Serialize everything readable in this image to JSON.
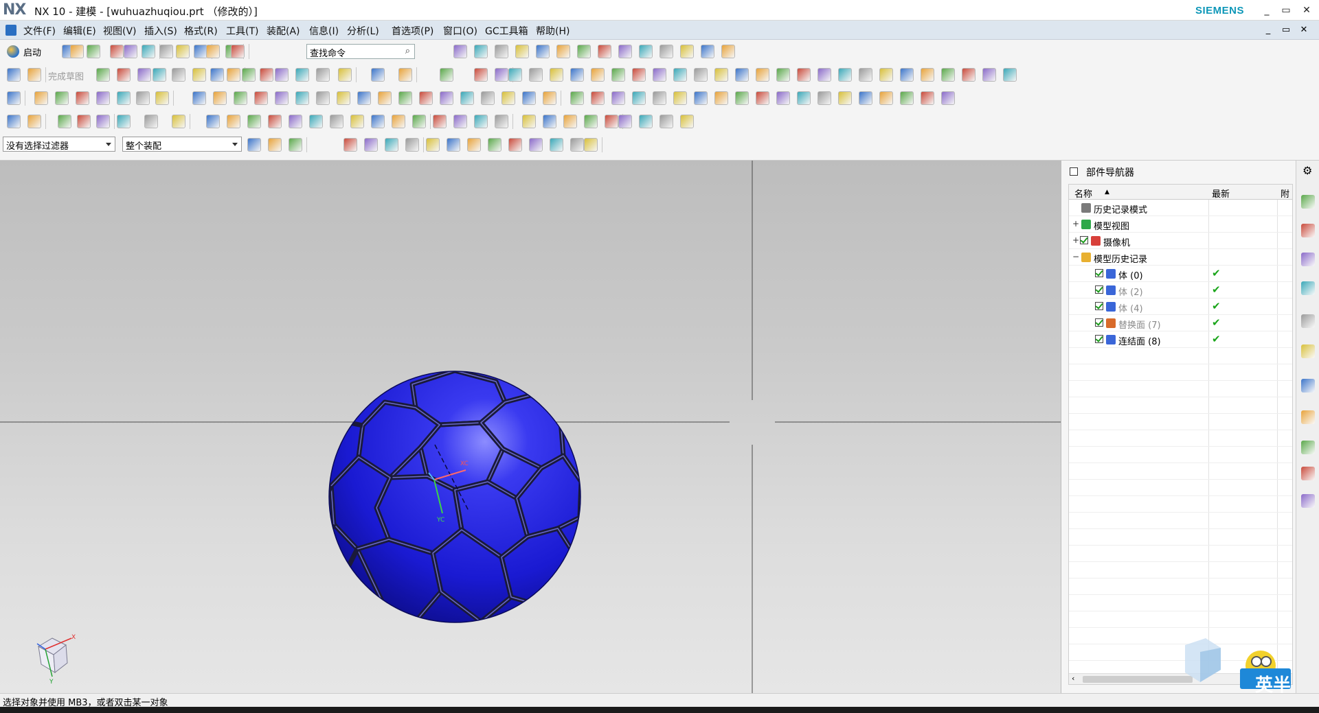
{
  "window": {
    "logo": "NX",
    "title": "NX 10 - 建模 - [wuhuazhuqiou.prt （修改的）]",
    "brand": "SIEMENS",
    "controls": [
      "_",
      "▭",
      "✕"
    ]
  },
  "menu": {
    "items": [
      "文件(F)",
      "编辑(E)",
      "视图(V)",
      "插入(S)",
      "格式(R)",
      "工具(T)",
      "装配(A)",
      "信息(I)",
      "分析(L)",
      "首选项(P)",
      "窗口(O)",
      "GC工具箱",
      "帮助(H)"
    ],
    "controls": [
      "_",
      "▭",
      "✕"
    ]
  },
  "toolbar": {
    "launch_label": "启动",
    "finish_sketch_label": "完成草图",
    "command_search_placeholder": "查找命令",
    "selection_filter": "没有选择过滤器",
    "assembly_scope": "整个装配"
  },
  "viewport": {
    "wcs_labels": [
      "XC",
      "YC"
    ],
    "triad_labels": [
      "X",
      "Y"
    ],
    "model": "soccer ball",
    "background_top": "#bdbdbd",
    "background_bottom": "#e6e6e6",
    "model_color": "#1d1dd8"
  },
  "navigator": {
    "title": "部件导航器",
    "columns": [
      "名称",
      "最新",
      "附"
    ],
    "rows": [
      {
        "label": "历史记录模式",
        "indent": 0,
        "expander": "",
        "icon": "clock-icon",
        "check": false,
        "latest": "",
        "dim": false
      },
      {
        "label": "模型视图",
        "indent": 0,
        "expander": "+",
        "icon": "model-view-icon",
        "check": false,
        "latest": "",
        "dim": false
      },
      {
        "label": "摄像机",
        "indent": 0,
        "expander": "+",
        "icon": "camera-icon",
        "check": true,
        "latest": "",
        "dim": false
      },
      {
        "label": "模型历史记录",
        "indent": 0,
        "expander": "−",
        "icon": "folder-icon",
        "check": false,
        "latest": "",
        "dim": false
      },
      {
        "label": "体 (0)",
        "indent": 1,
        "expander": "",
        "icon": "body-icon",
        "check": true,
        "latest": "✔",
        "dim": false
      },
      {
        "label": "体 (2)",
        "indent": 1,
        "expander": "",
        "icon": "body-icon",
        "check": true,
        "latest": "✔",
        "dim": true
      },
      {
        "label": "体 (4)",
        "indent": 1,
        "expander": "",
        "icon": "body-icon",
        "check": true,
        "latest": "✔",
        "dim": true
      },
      {
        "label": "替换面 (7)",
        "indent": 1,
        "expander": "",
        "icon": "replace-face-icon",
        "check": true,
        "latest": "✔",
        "dim": true
      },
      {
        "label": "连结面 (8)",
        "indent": 1,
        "expander": "",
        "icon": "unite-face-icon",
        "check": true,
        "latest": "✔",
        "dim": false
      }
    ]
  },
  "status": {
    "prompt": "选择对象并使用 MB3，或者双击某一对象"
  },
  "watermark": {
    "text": "英半"
  },
  "colors": {
    "menubar": "#dde6ef",
    "check_green": "#1aa51a",
    "siemens": "#0d97b8"
  }
}
